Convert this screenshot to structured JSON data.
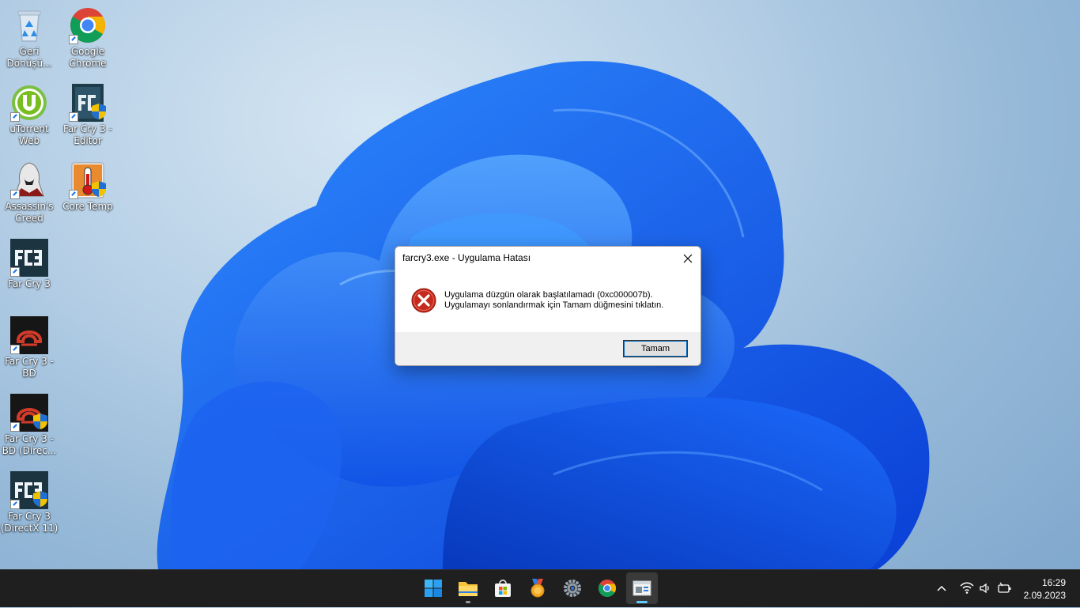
{
  "desktop": {
    "icons": [
      {
        "label": "Geri Dönüşü...",
        "icon": "recycle-bin-icon"
      },
      {
        "label": "Google Chrome",
        "icon": "chrome-icon"
      },
      {
        "label": "uTorrent Web",
        "icon": "utorrent-icon"
      },
      {
        "label": "Far Cry 3 - Editor",
        "icon": "farcry3-editor-icon"
      },
      {
        "label": "Assassin's Creed",
        "icon": "assassins-creed-icon"
      },
      {
        "label": "Core Temp",
        "icon": "core-temp-icon"
      },
      {
        "label": "Far Cry 3",
        "icon": "farcry3-icon"
      },
      {
        "label": "Far Cry 3 - BD",
        "icon": "farcry3-bd-icon"
      },
      {
        "label": "Far Cry 3 - BD (Direc...",
        "icon": "farcry3-bd-directx-icon"
      },
      {
        "label": "Far Cry 3 (DirectX 11)",
        "icon": "farcry3-dx11-icon"
      }
    ]
  },
  "dialog": {
    "title": "farcry3.exe - Uygulama Hatası",
    "message_line1": "Uygulama düzgün olarak başlatılamadı (0xc000007b).",
    "message_line2": "Uygulamayı sonlandırmak için Tamam düğmesini tıklatın.",
    "ok_label": "Tamam"
  },
  "taskbar": {
    "apps": [
      "start-icon",
      "file-explorer-icon",
      "microsoft-store-icon",
      "medal-app-icon",
      "settings-icon",
      "chrome-icon",
      "app-window-icon"
    ],
    "clock_time": "16:29",
    "clock_date": "2.09.2023"
  },
  "colors": {
    "taskbar_bg": "#1f1f1f",
    "accent": "#60cdff",
    "error_red": "#c42b1c"
  }
}
